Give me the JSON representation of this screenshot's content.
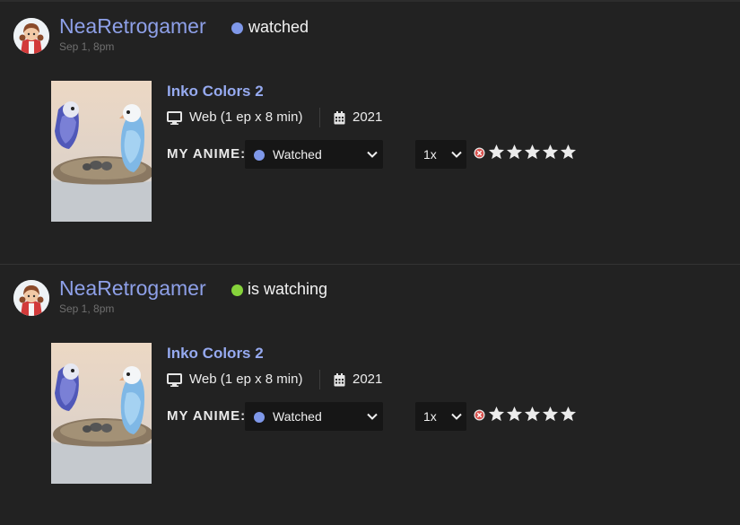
{
  "feed": [
    {
      "user": {
        "name": "NeaRetrogamer",
        "timestamp": "Sep 1, 8pm"
      },
      "activity": {
        "text": "watched",
        "color": "#7f98e9"
      },
      "anime": {
        "title": "Inko Colors 2",
        "format": "Web (1 ep x 8 min)",
        "year": "2021",
        "format_icon": "monitor-icon",
        "year_icon": "calendar-icon"
      },
      "my_anime": {
        "label": "MY ANIME:",
        "status_value": "Watched",
        "status_color": "#7f98e9",
        "rewatch_value": "1x",
        "rating": 0,
        "rating_max": 5
      }
    },
    {
      "user": {
        "name": "NeaRetrogamer",
        "timestamp": "Sep 1, 8pm"
      },
      "activity": {
        "text": "is watching",
        "color": "#86d33b"
      },
      "anime": {
        "title": "Inko Colors 2",
        "format": "Web (1 ep x 8 min)",
        "year": "2021",
        "format_icon": "monitor-icon",
        "year_icon": "calendar-icon"
      },
      "my_anime": {
        "label": "MY ANIME:",
        "status_value": "Watched",
        "status_color": "#7f98e9",
        "rewatch_value": "1x",
        "rating": 0,
        "rating_max": 5
      }
    }
  ]
}
